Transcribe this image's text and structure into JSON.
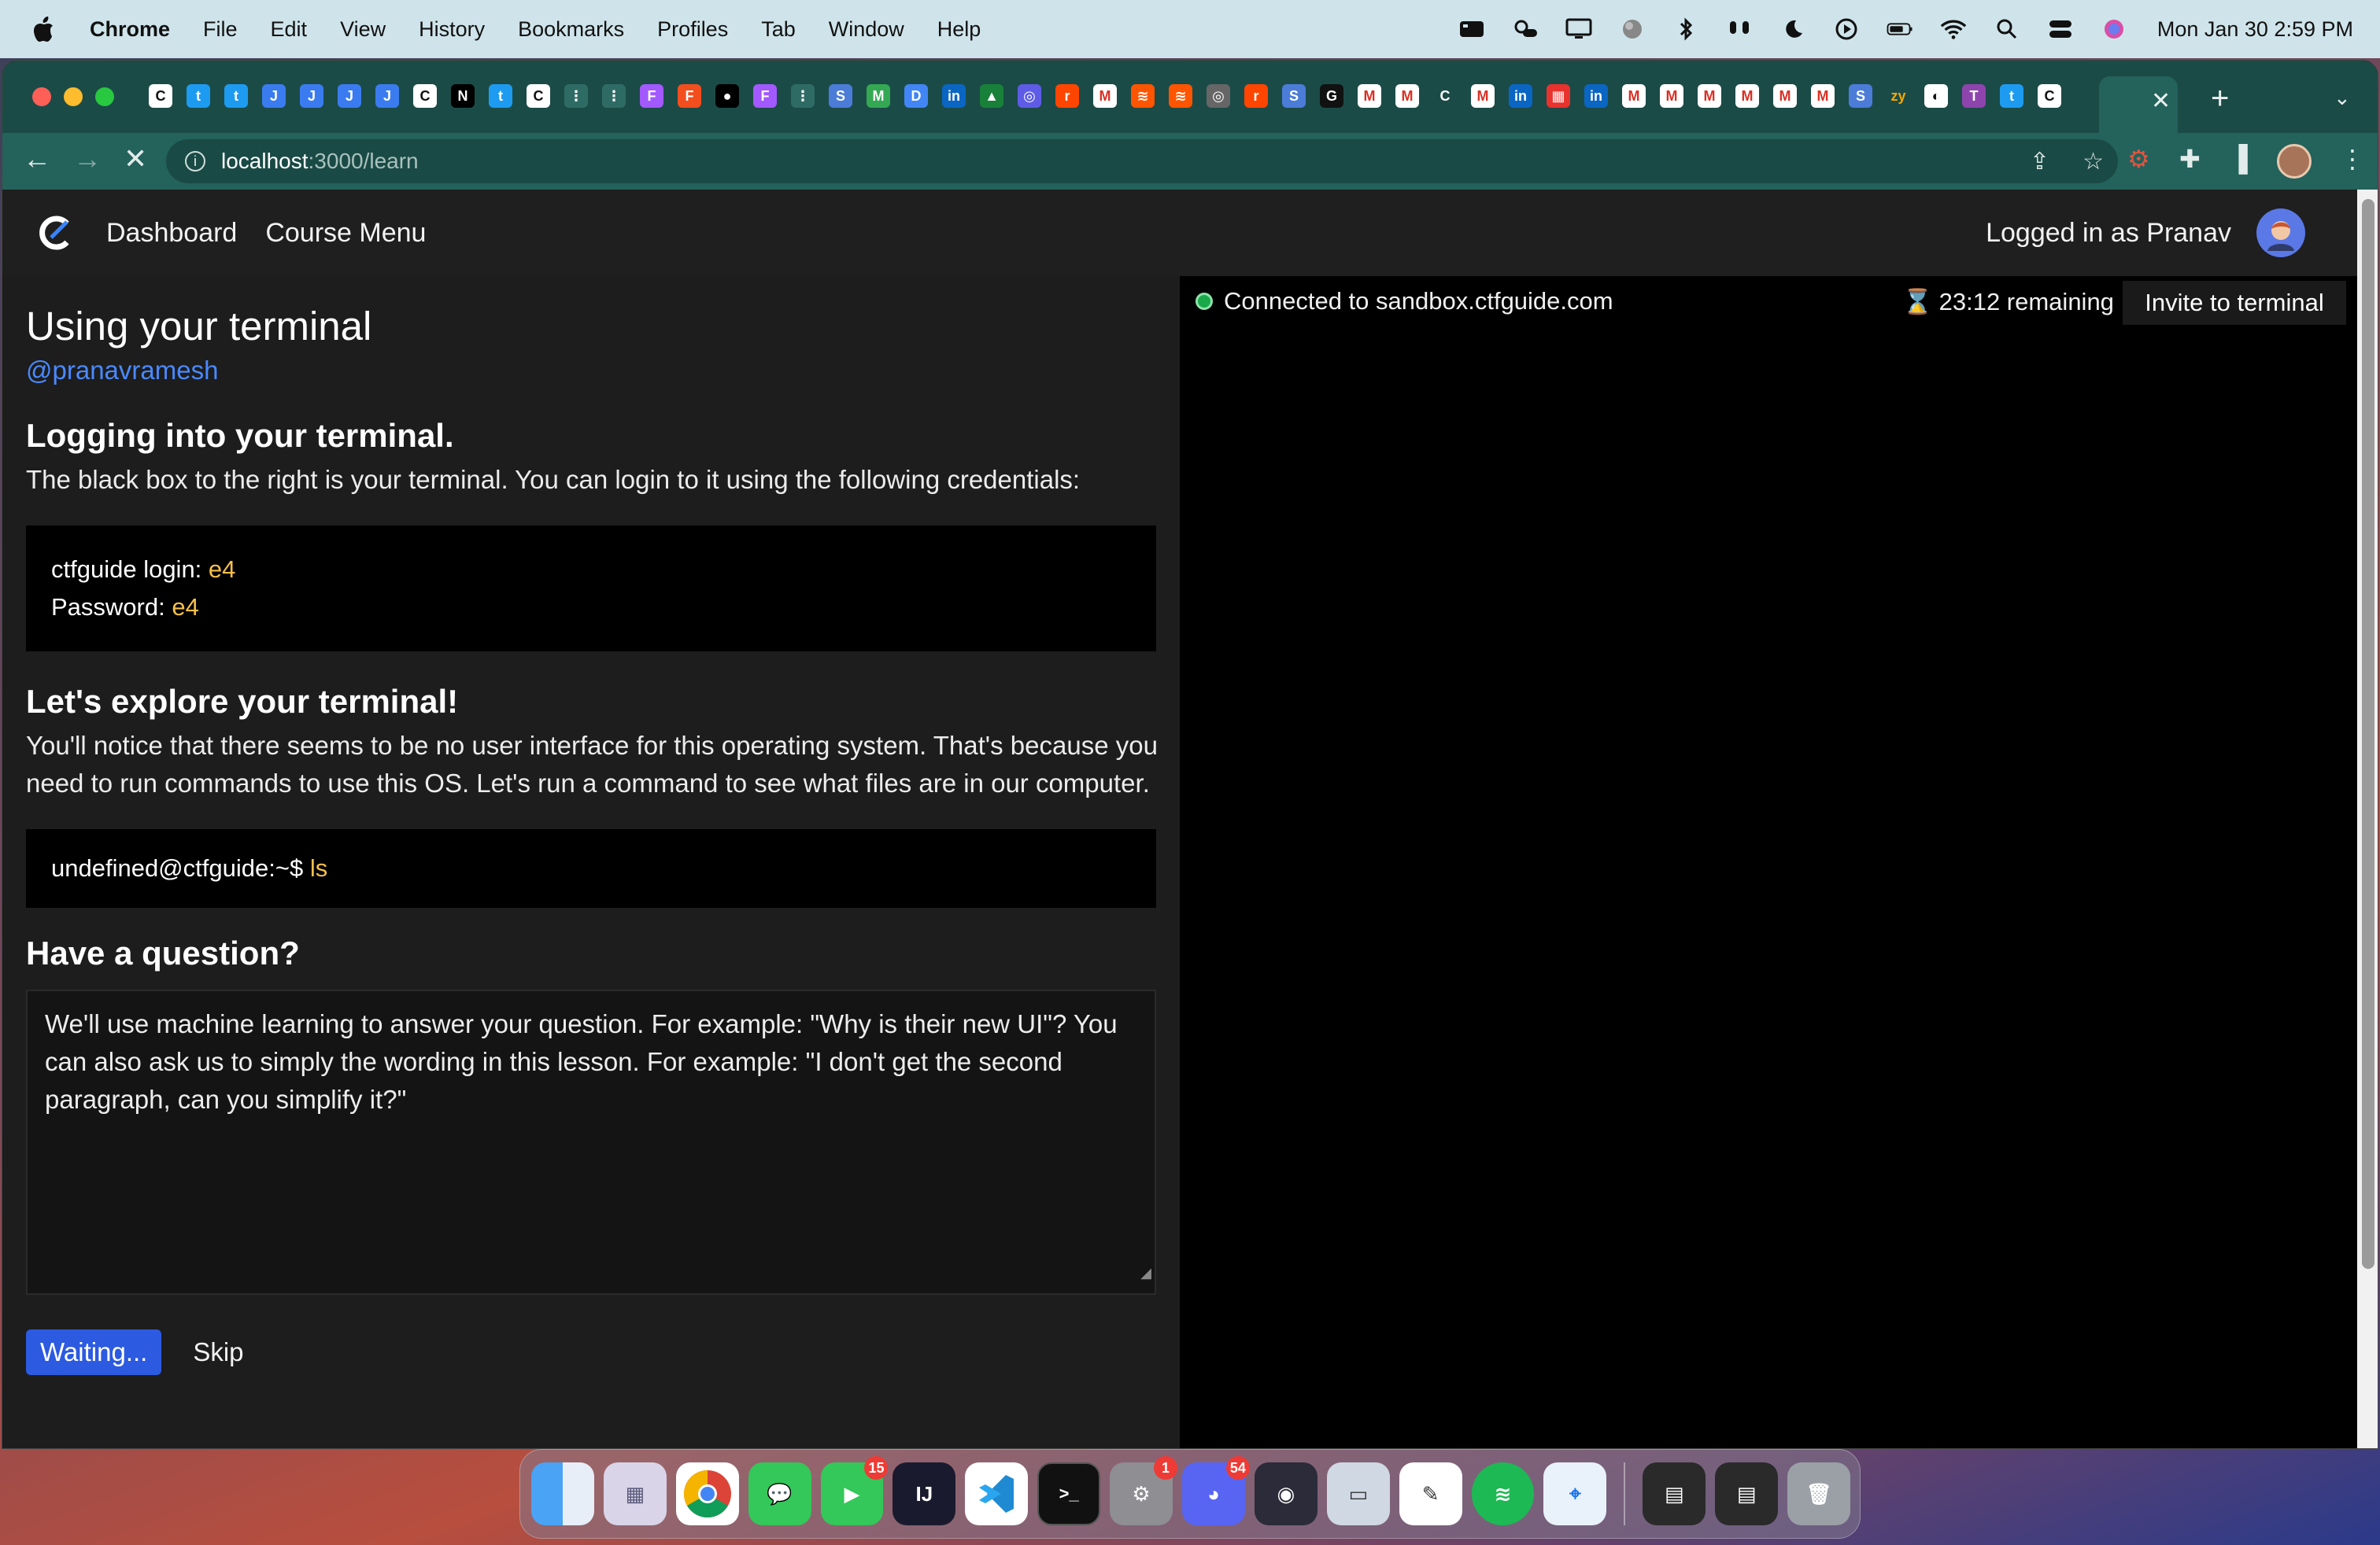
{
  "menubar": {
    "app_name": "Chrome",
    "items": [
      "File",
      "Edit",
      "View",
      "History",
      "Bookmarks",
      "Profiles",
      "Tab",
      "Window",
      "Help"
    ],
    "clock": "Mon Jan 30  2:59 PM"
  },
  "browser": {
    "url_host": "localhost",
    "url_path": ":3000/learn"
  },
  "app": {
    "nav_links": [
      "Dashboard",
      "Course Menu"
    ],
    "logged_in": "Logged in as Pranav"
  },
  "lesson": {
    "title": "Using your terminal",
    "author": "@pranavramesh",
    "section1_heading": "Logging into your terminal.",
    "section1_body": "The black box to the right is your terminal. You can login to it using the following credentials:",
    "login_label": "ctfguide login: ",
    "login_value": "e4",
    "password_label": "Password: ",
    "password_value": "e4",
    "section2_heading": "Let's explore your terminal!",
    "section2_body": "You'll notice that there seems to be no user interface for this operating system. That's because you need to run commands to use this OS. Let's run a command to see what files are in our computer.",
    "prompt": "undefined@ctfguide:~$ ",
    "command": "ls",
    "question_heading": "Have a question?",
    "question_placeholder": "We'll use machine learning to answer your question. For example: \"Why is their new UI\"? You can also ask us to simply the wording in this lesson. For example: \"I don't get the second paragraph, can you simplify it?\"",
    "waiting_button": "Waiting...",
    "skip_button": "Skip"
  },
  "terminal": {
    "status": "Connected to sandbox.ctfguide.com",
    "timer": "23:12 remaining",
    "invite_button": "Invite to terminal"
  },
  "dock": {
    "facetime_badge": "15",
    "settings_badge": "1",
    "discord_badge": "54"
  },
  "colors": {
    "accent_blue": "#4a89ff",
    "highlight_yellow": "#f6c04a",
    "tab_green": "#1b4b47"
  }
}
